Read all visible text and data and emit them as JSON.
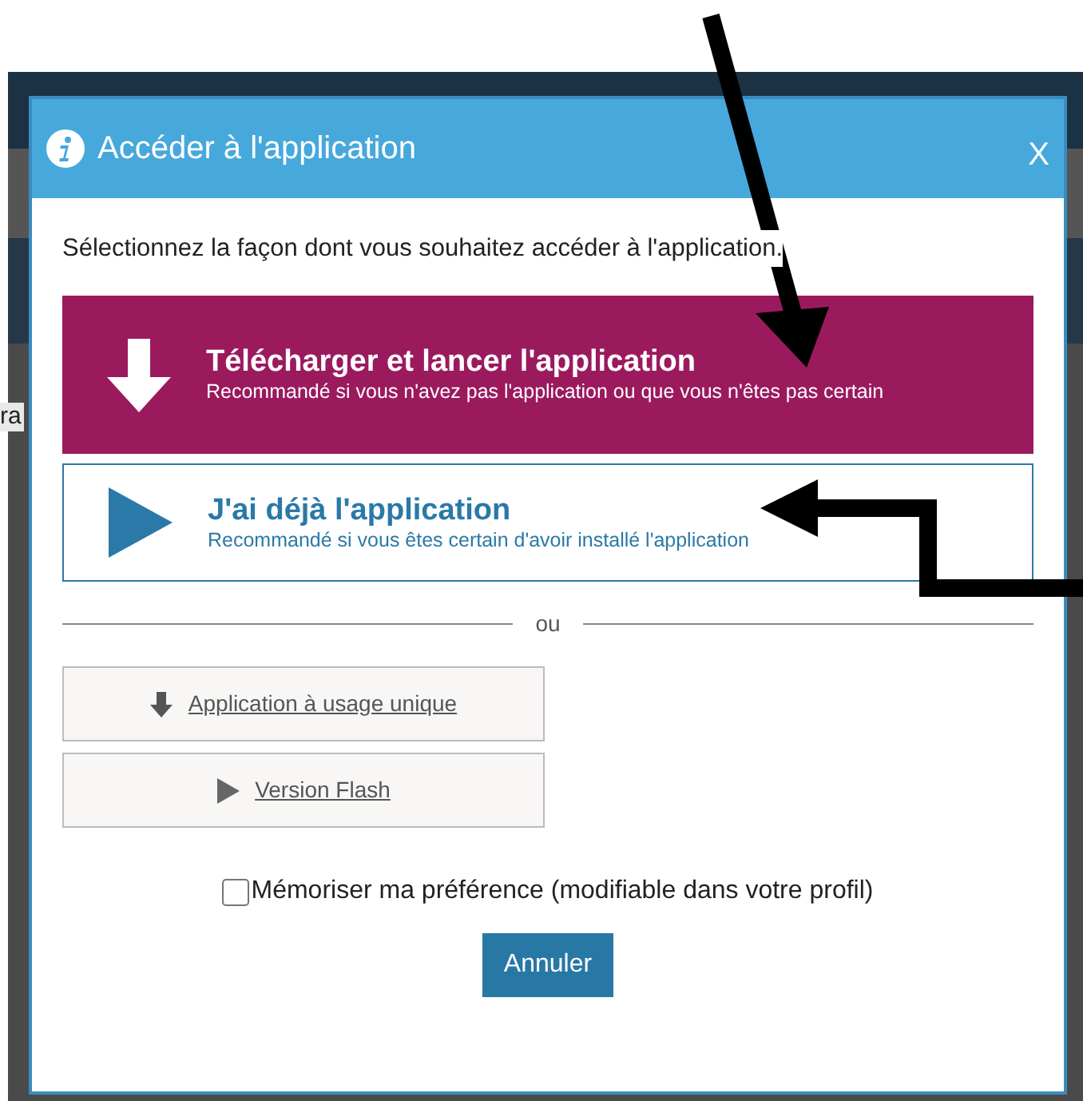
{
  "background_page": {
    "fragment": "ra"
  },
  "dialog": {
    "title": "Accéder à l'application",
    "close": "X",
    "intro": "Sélectionnez la façon dont vous souhaitez accéder à l'application.",
    "options": [
      {
        "kind": "download",
        "title": "Télécharger et lancer l'application",
        "description": "Recommandé si vous n'avez pas l'application ou que vous n'êtes pas certain"
      },
      {
        "kind": "launch",
        "title": "J'ai déjà l'application",
        "description": "Recommandé si vous êtes certain d'avoir installé l'application"
      }
    ],
    "divider": "ou",
    "alternatives": [
      {
        "kind": "download",
        "label": "Application à usage unique"
      },
      {
        "kind": "play",
        "label": "Version Flash"
      }
    ],
    "remember": {
      "label": "Mémoriser ma préférence (modifiable dans votre profil)",
      "checked": false
    },
    "cancel": "Annuler"
  }
}
